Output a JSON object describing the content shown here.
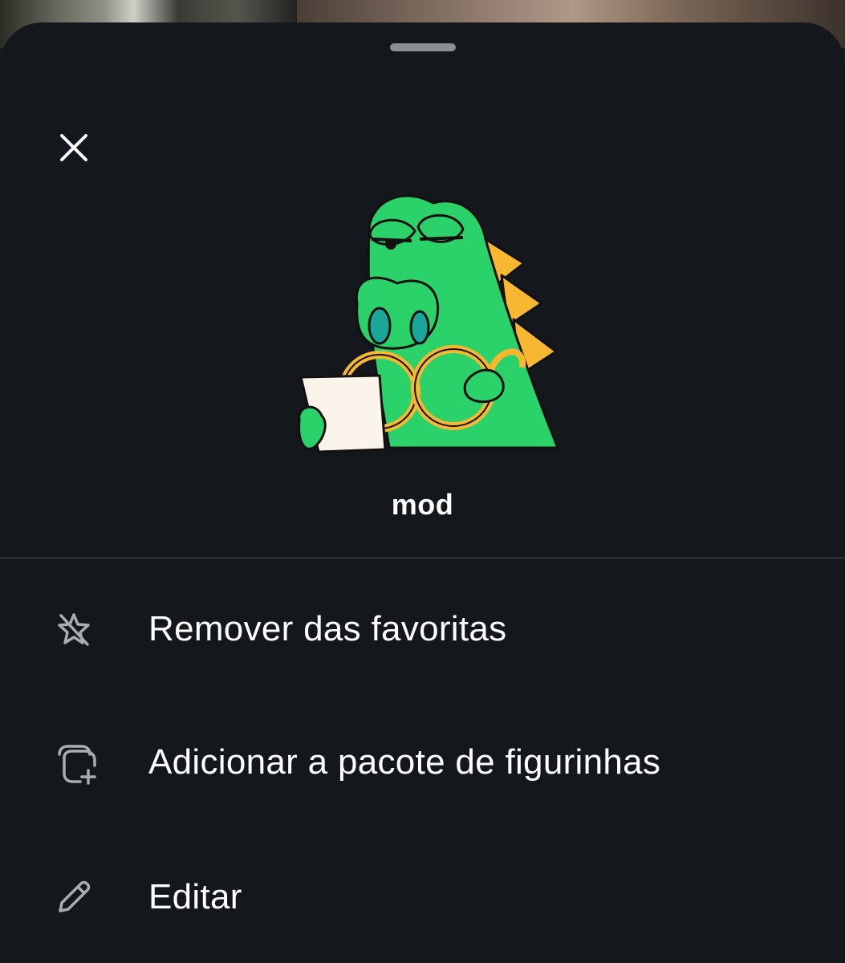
{
  "sheet": {
    "sticker_name": "mod",
    "close_icon": "close-icon"
  },
  "menu": {
    "items": [
      {
        "label": "Remover das favoritas",
        "icon": "star-off-icon"
      },
      {
        "label": "Adicionar a pacote de figurinhas",
        "icon": "sticker-add-icon"
      },
      {
        "label": "Editar",
        "icon": "pencil-icon"
      }
    ]
  },
  "colors": {
    "sheet_background": "#14181d",
    "text": "#ffffff",
    "icon": "#a9adb2",
    "sticker_green": "#2bd26a",
    "sticker_orange": "#f7b731"
  }
}
